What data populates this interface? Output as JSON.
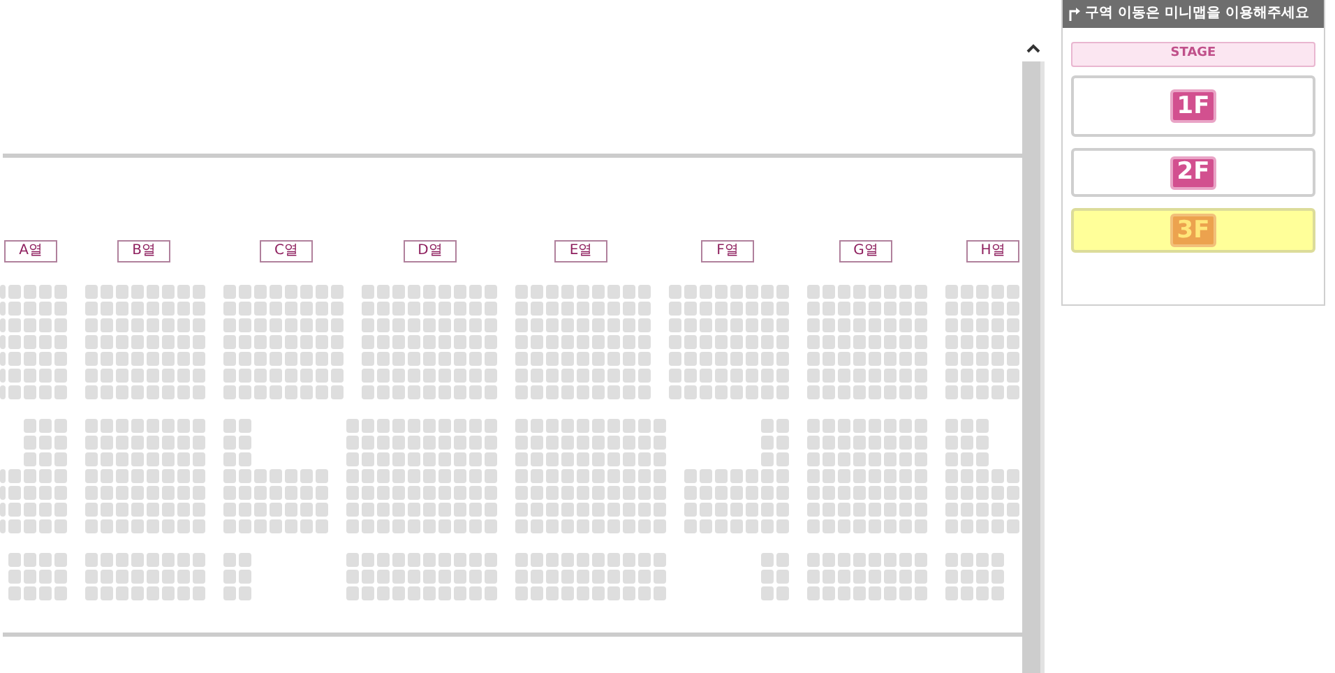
{
  "sections": [
    {
      "label": "A열"
    },
    {
      "label": "B열"
    },
    {
      "label": "C열"
    },
    {
      "label": "D열"
    },
    {
      "label": "E열"
    },
    {
      "label": "F열"
    },
    {
      "label": "G열"
    },
    {
      "label": "H열"
    }
  ],
  "minimap": {
    "notice": "구역 이동은 미니맵을 이용해주세요",
    "stage": "STAGE",
    "floors": [
      {
        "label": "1F",
        "selected": false
      },
      {
        "label": "2F",
        "selected": false
      },
      {
        "label": "3F",
        "selected": true
      }
    ]
  }
}
